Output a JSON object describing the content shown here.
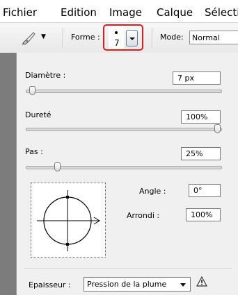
{
  "menubar": {
    "items": [
      "Fichier",
      "Edition",
      "Image",
      "Calque",
      "Sélecti"
    ]
  },
  "toolbar": {
    "tool_icon": "brush-tool-icon",
    "tool_dropdown_icon": "triangle-down-icon",
    "forme_label": "Forme :",
    "brush_size": "7",
    "brush_picker_icon": "chevron-down-icon",
    "mode_label": "Mode:",
    "mode_value": "Normal",
    "highlight_color": "#e01b1b"
  },
  "panel": {
    "diametre_label": "Diamètre :",
    "diametre_value": "7 px",
    "diametre_level": 0.02,
    "durete_label": "Dureté",
    "durete_value": "100%",
    "durete_level": 1.0,
    "pas_label": "Pas :",
    "pas_value": "25%",
    "pas_level": 0.15,
    "angle_label": "Angle :",
    "angle_value": "0°",
    "arrondi_label": "Arrondi :",
    "arrondi_value": "100%",
    "preview_icon": "brush-angle-roundness-preview-icon",
    "epaisseur_label": "Epaisseur :",
    "epaisseur_value": "Pression de la plume",
    "warning_icon": "warning-triangle-icon"
  }
}
